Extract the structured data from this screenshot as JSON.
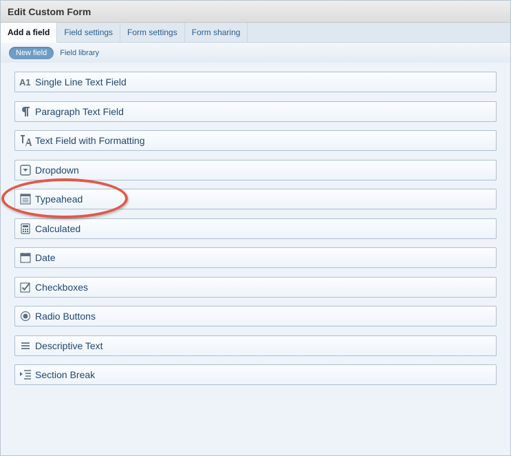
{
  "window": {
    "title": "Edit Custom Form"
  },
  "tabs": [
    {
      "label": "Add a field",
      "active": true
    },
    {
      "label": "Field settings",
      "active": false
    },
    {
      "label": "Form settings",
      "active": false
    },
    {
      "label": "Form sharing",
      "active": false
    }
  ],
  "subnav": {
    "new_field": "New field",
    "field_library": "Field library"
  },
  "fields": [
    {
      "label": "Single Line Text Field",
      "icon": "a1-text-icon"
    },
    {
      "label": "Paragraph Text Field",
      "icon": "pilcrow-icon"
    },
    {
      "label": "Text Field with Formatting",
      "icon": "formatting-icon"
    },
    {
      "label": "Dropdown",
      "icon": "dropdown-icon"
    },
    {
      "label": "Typeahead",
      "icon": "typeahead-icon"
    },
    {
      "label": "Calculated",
      "icon": "calculator-icon"
    },
    {
      "label": "Date",
      "icon": "calendar-icon"
    },
    {
      "label": "Checkboxes",
      "icon": "checkbox-icon"
    },
    {
      "label": "Radio Buttons",
      "icon": "radio-icon"
    },
    {
      "label": "Descriptive Text",
      "icon": "lines-icon"
    },
    {
      "label": "Section Break",
      "icon": "section-break-icon"
    }
  ],
  "annotation": {
    "highlighted_field": "Typeahead",
    "color": "#e25847"
  }
}
